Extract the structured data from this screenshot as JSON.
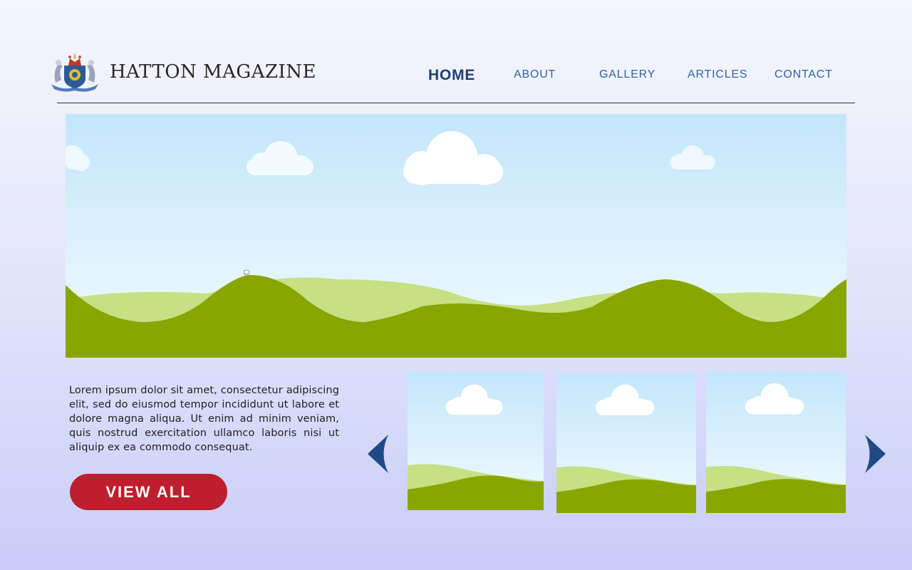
{
  "header": {
    "brand_name": "HATTON MAGAZINE",
    "logo_icon": "coat-of-arms-icon"
  },
  "nav": {
    "items": [
      {
        "label": "HOME",
        "active": true
      },
      {
        "label": "ABOUT",
        "active": false
      },
      {
        "label": "GALLERY",
        "active": false
      },
      {
        "label": "ARTICLES",
        "active": false
      },
      {
        "label": "CONTACT",
        "active": false
      }
    ]
  },
  "hero": {
    "image_icon": "landscape-illustration"
  },
  "content": {
    "blurb": "Lorem ipsum dolor sit amet, consectetur adipiscing elit, sed do eiusmod tempor incididunt ut labore et dolore magna aliqua. Ut enim ad minim veniam, quis nostrud exercitation ullamco laboris nisi ut aliquip ex ea commodo consequat.",
    "view_all_label": "VIEW ALL"
  },
  "carousel": {
    "prev_icon": "chevron-left-icon",
    "next_icon": "chevron-right-icon",
    "thumbnail_count": 3
  },
  "colors": {
    "nav_text": "#2f63a8",
    "nav_active": "#1f3f73",
    "button_bg": "#be1e2d",
    "arrow": "#1f4a86",
    "sky_top": "#c3e6fc",
    "hill_dark": "#89a500",
    "hill_light": "#c6e084"
  }
}
